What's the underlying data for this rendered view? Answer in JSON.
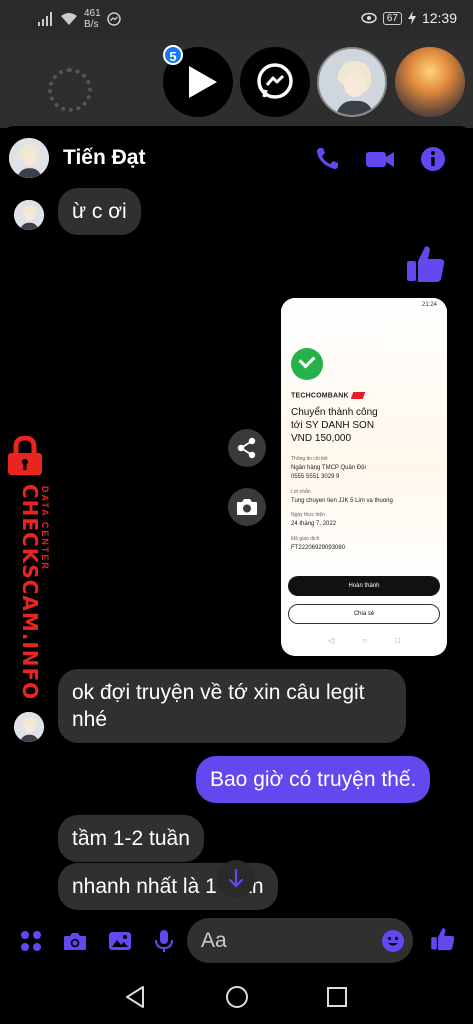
{
  "status": {
    "speed_value": "461",
    "speed_unit": "B/s",
    "battery": "67",
    "time": "12:39"
  },
  "chat_heads": {
    "badge_count": "5"
  },
  "header": {
    "contact_name": "Tiến Đạt"
  },
  "messages": [
    {
      "from": "them",
      "text": "ừ c ơi"
    },
    {
      "from": "me",
      "type": "like"
    },
    {
      "from": "me",
      "type": "image"
    },
    {
      "from": "them",
      "text_line1": "ok đợi truyện về tớ xin câu legit",
      "text_line2": "nhé"
    },
    {
      "from": "me",
      "text": "Bao giờ có truyện thế."
    },
    {
      "from": "them",
      "text": "tầm 1-2 tuần"
    },
    {
      "from": "them",
      "text": "nhanh nhất là 1 tuần"
    }
  ],
  "receipt": {
    "time": "21:24",
    "bank": "TECHCOMBANK",
    "line1": "Chuyển thành công",
    "line2": "tới SY DANH SON",
    "amount": "VND 150,000",
    "section_title": "Thông tin chi tiết",
    "bank_name": "Ngân hàng TMCP Quân Đội",
    "account": "0555 5551 3029 9",
    "note_label": "Lời nhắn",
    "note": "Tung chuyen tien JJK 5 Lim  va thuong",
    "date_label": "Ngày thực hiện",
    "date": "24 tháng 7, 2022",
    "code_label": "Mã giao dịch",
    "code": "FT22206929093080",
    "button_done": "Hoàn thành",
    "button_share": "Chia sẻ"
  },
  "watermark": {
    "main": "CHECKSCAM.INFO",
    "sub": "DATA CENTER"
  },
  "composer": {
    "placeholder": "Aa"
  },
  "colors": {
    "accent": "#6447ef",
    "bubble_other": "#303030",
    "watermark": "#e8251f"
  }
}
